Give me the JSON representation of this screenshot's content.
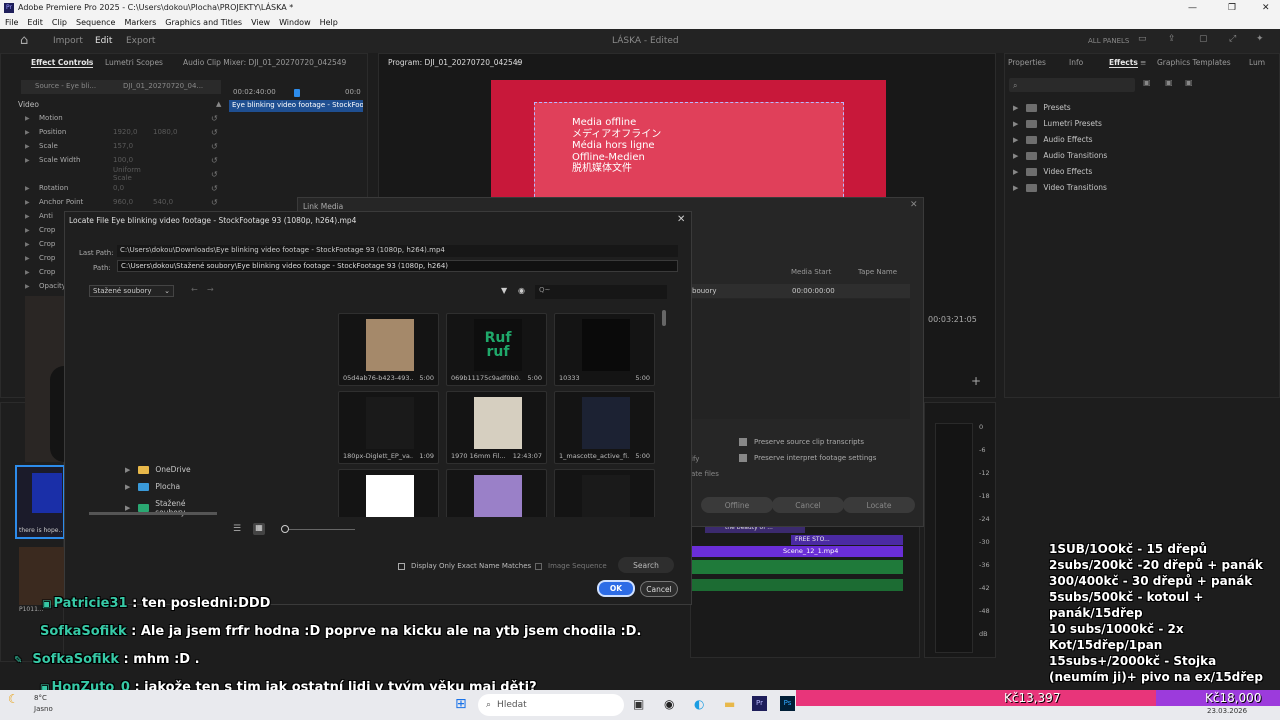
{
  "titlebar": {
    "title": "Adobe Premiere Pro 2025 - C:\\Users\\dokou\\Plocha\\PROJEKTY\\LÁSKA *"
  },
  "menu": [
    "File",
    "Edit",
    "Clip",
    "Sequence",
    "Markers",
    "Graphics and Titles",
    "View",
    "Window",
    "Help"
  ],
  "header": {
    "tabs": [
      "Import",
      "Edit",
      "Export"
    ],
    "project": "LÁSKA - Edited",
    "all_panels": "ALL PANELS"
  },
  "effect_controls": {
    "tabs": [
      "Effect Controls",
      "Lumetri Scopes",
      "Audio Clip Mixer: DJI_01_20270720_042549"
    ],
    "source": "Source - Eye bli...",
    "seq": "DJI_01_20270720_04...",
    "timecode": "00:02:40:00",
    "timecode2": "00:0",
    "clip": "Eye blinking video footage - StockFootage",
    "section": "Video",
    "props": [
      {
        "label": "Motion",
        "v1": "",
        "v2": ""
      },
      {
        "label": "Position",
        "v1": "1920,0",
        "v2": "1080,0"
      },
      {
        "label": "Scale",
        "v1": "157,0",
        "v2": ""
      },
      {
        "label": "Scale Width",
        "v1": "100,0",
        "v2": ""
      },
      {
        "label": "",
        "v1": "Uniform Scale",
        "v2": ""
      },
      {
        "label": "Rotation",
        "v1": "0,0",
        "v2": ""
      },
      {
        "label": "Anchor Point",
        "v1": "960,0",
        "v2": "540,0"
      },
      {
        "label": "Anti",
        "v1": "",
        "v2": ""
      },
      {
        "label": "Crop",
        "v1": "",
        "v2": ""
      },
      {
        "label": "Crop",
        "v1": "",
        "v2": ""
      },
      {
        "label": "Crop",
        "v1": "",
        "v2": ""
      },
      {
        "label": "Crop",
        "v1": "",
        "v2": ""
      },
      {
        "label": "Opacity",
        "v1": "",
        "v2": ""
      }
    ]
  },
  "program": {
    "title": "Program: DJI_01_20270720_042549",
    "offline": [
      "Media offline",
      "メディアオフライン",
      "Média hors ligne",
      "Offline-Medien",
      "脱机媒体文件"
    ],
    "timecode": "00:03:21:05"
  },
  "effects_panel": {
    "tabs": [
      "Properties",
      "Info",
      "Effects",
      "Graphics Templates",
      "Lum"
    ],
    "items": [
      "Presets",
      "Lumetri Presets",
      "Audio Effects",
      "Audio Transitions",
      "Video Effects",
      "Video Transitions"
    ]
  },
  "link_media": {
    "title": "Link Media",
    "cols": [
      "Media Start",
      "Tape Name"
    ],
    "row": {
      "name": "bouory",
      "start": "00:00:00:00"
    },
    "check1": "Preserve source clip transcripts",
    "check2": "Preserve interpret footage settings",
    "partial1": "ify",
    "partial2": "ate files",
    "buttons": [
      "Offline",
      "Cancel",
      "Locate"
    ]
  },
  "locate": {
    "title": "Locate File Eye blinking video footage - StockFootage 93 (1080p, h264).mp4",
    "last_path_label": "Last Path:",
    "last_path": "C:\\Users\\dokou\\Downloads\\Eye blinking video footage - StockFootage 93 (1080p, h264).mp4",
    "path_label": "Path:",
    "path": "C:\\Users\\dokou\\Stažené soubory\\Eye blinking video footage - StockFootage 93 (1080p, h264)",
    "folder_select": "Stažené soubory",
    "search_placeholder": "Q~",
    "tree": [
      "OneDrive",
      "Plocha",
      "Stažené soubory"
    ],
    "thumbs": [
      {
        "name": "",
        "dur": "5:00"
      },
      {
        "name": "05d4ab76-b423-493...",
        "dur": "5:00"
      },
      {
        "name": "069b11175c9adf0b0...",
        "dur": "5:00"
      },
      {
        "name": "10333",
        "dur": "5:00"
      },
      {
        "name": "966-65...",
        "dur": "0:4"
      },
      {
        "name": "180px-Diglett_EP_va...",
        "dur": "1:09"
      },
      {
        "name": "1970 16mm Fil...",
        "dur": "12:43:07"
      },
      {
        "name": "1_mascotte_active_fi...",
        "dur": "5:00"
      },
      {
        "name": "",
        "dur": ""
      },
      {
        "name": "",
        "dur": ""
      },
      {
        "name": "",
        "dur": ""
      },
      {
        "name": "",
        "dur": ""
      }
    ],
    "ruf_text": "Ruf ruf",
    "exact_match": "Display Only Exact Name Matches",
    "image_seq": "Image Sequence",
    "search_btn": "Search",
    "ok": "OK",
    "cancel": "Cancel"
  },
  "timeline": {
    "clips": [
      "FREE STO...",
      "Scene_12_1.mp4",
      "the beauty of ..."
    ],
    "db": [
      "0",
      "-6",
      "-12",
      "-18",
      "-24",
      "-30",
      "-36",
      "-42",
      "-48",
      "dB"
    ]
  },
  "project_panel": {
    "label": "there is hope..",
    "thumb2": "P1011..."
  },
  "chat": [
    {
      "user": "Patricie31",
      "msg": ": ten posledni:DDD"
    },
    {
      "user": "SofkaSofikk",
      "msg": ": Ale ja jsem frfr hodna :D poprve na kicku ale na ytb jsem chodila :D."
    },
    {
      "user": "SofkaSofikk",
      "msg": ": mhm :D ."
    },
    {
      "user": "HonZuto_0",
      "msg": ": jakože ten s tim jak ostatní lidi v tvým věku maj děti?"
    }
  ],
  "pricelist": [
    "1SUB/1OOkč - 15 dřepů",
    "2subs/200kč -20 dřepů + panák",
    "300/400kč - 30 dřepů + panák",
    "5subs/500kč - kotoul + panák/15dřep",
    "10 subs/1000kč - 2x Kot/15dřep/1pan",
    "15subs+/2000kč - Stojka (neumím ji)+ pivo na ex/15dřep"
  ],
  "goal": {
    "current": "Kč13,397",
    "target": "Kč18,000",
    "progress": 0.744
  },
  "taskbar": {
    "temp": "8°C",
    "weather": "Jasno",
    "search": "Hledat",
    "date": "23.03.2026"
  },
  "colors": {
    "accent": "#2d8ceb",
    "offline_red": "#c8183a",
    "chat_user": "#37c9a6",
    "goal_pink": "#e8357a",
    "goal_purple": "#9c3bdc"
  }
}
